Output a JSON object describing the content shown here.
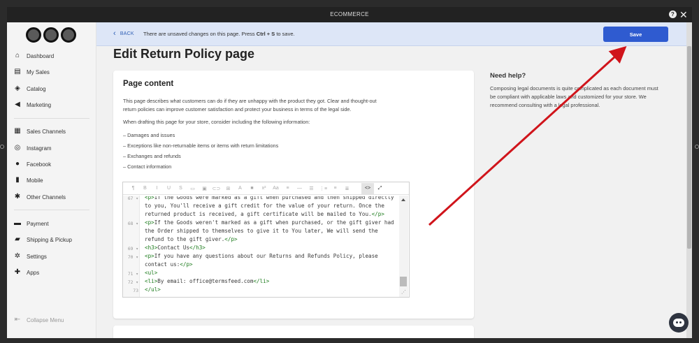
{
  "window": {
    "title": "ECOMMERCE",
    "help_label": "?",
    "close_label": "✕"
  },
  "logo": {
    "alt": "Store logo"
  },
  "sidebar": {
    "items": [
      {
        "label": "Dashboard",
        "icon": "home-icon",
        "glyph": "⌂"
      },
      {
        "label": "My Sales",
        "icon": "orders-icon",
        "glyph": "▤"
      },
      {
        "label": "Catalog",
        "icon": "tag-icon",
        "glyph": "◈"
      },
      {
        "label": "Marketing",
        "icon": "megaphone-icon",
        "glyph": "◀"
      },
      {
        "label": "Sales Channels",
        "icon": "store-icon",
        "glyph": "▦"
      },
      {
        "label": "Instagram",
        "icon": "instagram-icon",
        "glyph": "◎"
      },
      {
        "label": "Facebook",
        "icon": "facebook-icon",
        "glyph": "●"
      },
      {
        "label": "Mobile",
        "icon": "mobile-icon",
        "glyph": "▮"
      },
      {
        "label": "Other Channels",
        "icon": "share-icon",
        "glyph": "✱"
      },
      {
        "label": "Payment",
        "icon": "wallet-icon",
        "glyph": "▬"
      },
      {
        "label": "Shipping & Pickup",
        "icon": "truck-icon",
        "glyph": "▰"
      },
      {
        "label": "Settings",
        "icon": "gear-icon",
        "glyph": "✲"
      },
      {
        "label": "Apps",
        "icon": "puzzle-icon",
        "glyph": "✚"
      }
    ],
    "collapse_label": "Collapse Menu",
    "collapse_glyph": "⇤"
  },
  "banner": {
    "back_label": "BACK",
    "message_prefix": "There are unsaved changes on this page. Press ",
    "message_shortcut": "Ctrl + S",
    "message_suffix": " to save.",
    "save_label": "Save"
  },
  "page": {
    "title": "Edit Return Policy page"
  },
  "content": {
    "heading": "Page content",
    "intro_line1": "This page describes what customers can do if they are unhappy with the product they got. Clear and thought-out",
    "intro_line2": "return policies can improve customer satisfaction and protect your business in terms of the legal side.",
    "drafting": "When drafting this page for your store, consider including the following information:",
    "list": [
      "–  Damages and issues",
      "–  Exceptions like non-returnable items or items with return limitations",
      "–  Exchanges and refunds",
      "–  Contact information"
    ]
  },
  "editor": {
    "toolbar": [
      "¶",
      "B",
      "I",
      "U",
      "S",
      "▭",
      "▣",
      "⊂⊃",
      "⊞",
      "A",
      "■",
      "x²",
      "Aa",
      "≡",
      "—",
      "☰",
      "⋮≡",
      "≡",
      "≣",
      "<>",
      "⤢"
    ],
    "line_numbers": [
      "67 ▾",
      "",
      "",
      "68 ▾",
      "",
      "",
      "69 ▾",
      "70 ▾",
      "",
      "71 ▾",
      "72 ▾",
      "73"
    ],
    "lines": [
      "<p>If the Goods were marked as a gift when purchased and then shipped directly",
      "to you, You'll receive a gift credit for the value of your return. Once the",
      "returned product is received, a gift certificate will be mailed to You.</p>",
      "<p>If the Goods weren't marked as a gift when purchased, or the gift giver had",
      "the Order shipped to themselves to give it to You later, We will send the",
      "refund to the gift giver.</p>",
      "<h3>Contact Us</h3>",
      "<p>If you have any questions about our Returns and Refunds Policy, please",
      "contact us:</p>",
      "<ul>",
      "<li>By email: office@termsfeed.com</li>",
      "</ul>"
    ]
  },
  "help": {
    "title": "Need help?",
    "text": "Composing legal documents is quite complicated as each document must be compliant with applicable laws and customized for your store. We recommend consulting with a legal professional."
  },
  "colors": {
    "accent": "#2f5bd0",
    "banner": "#dde6f7",
    "annotation": "#d0141b"
  }
}
